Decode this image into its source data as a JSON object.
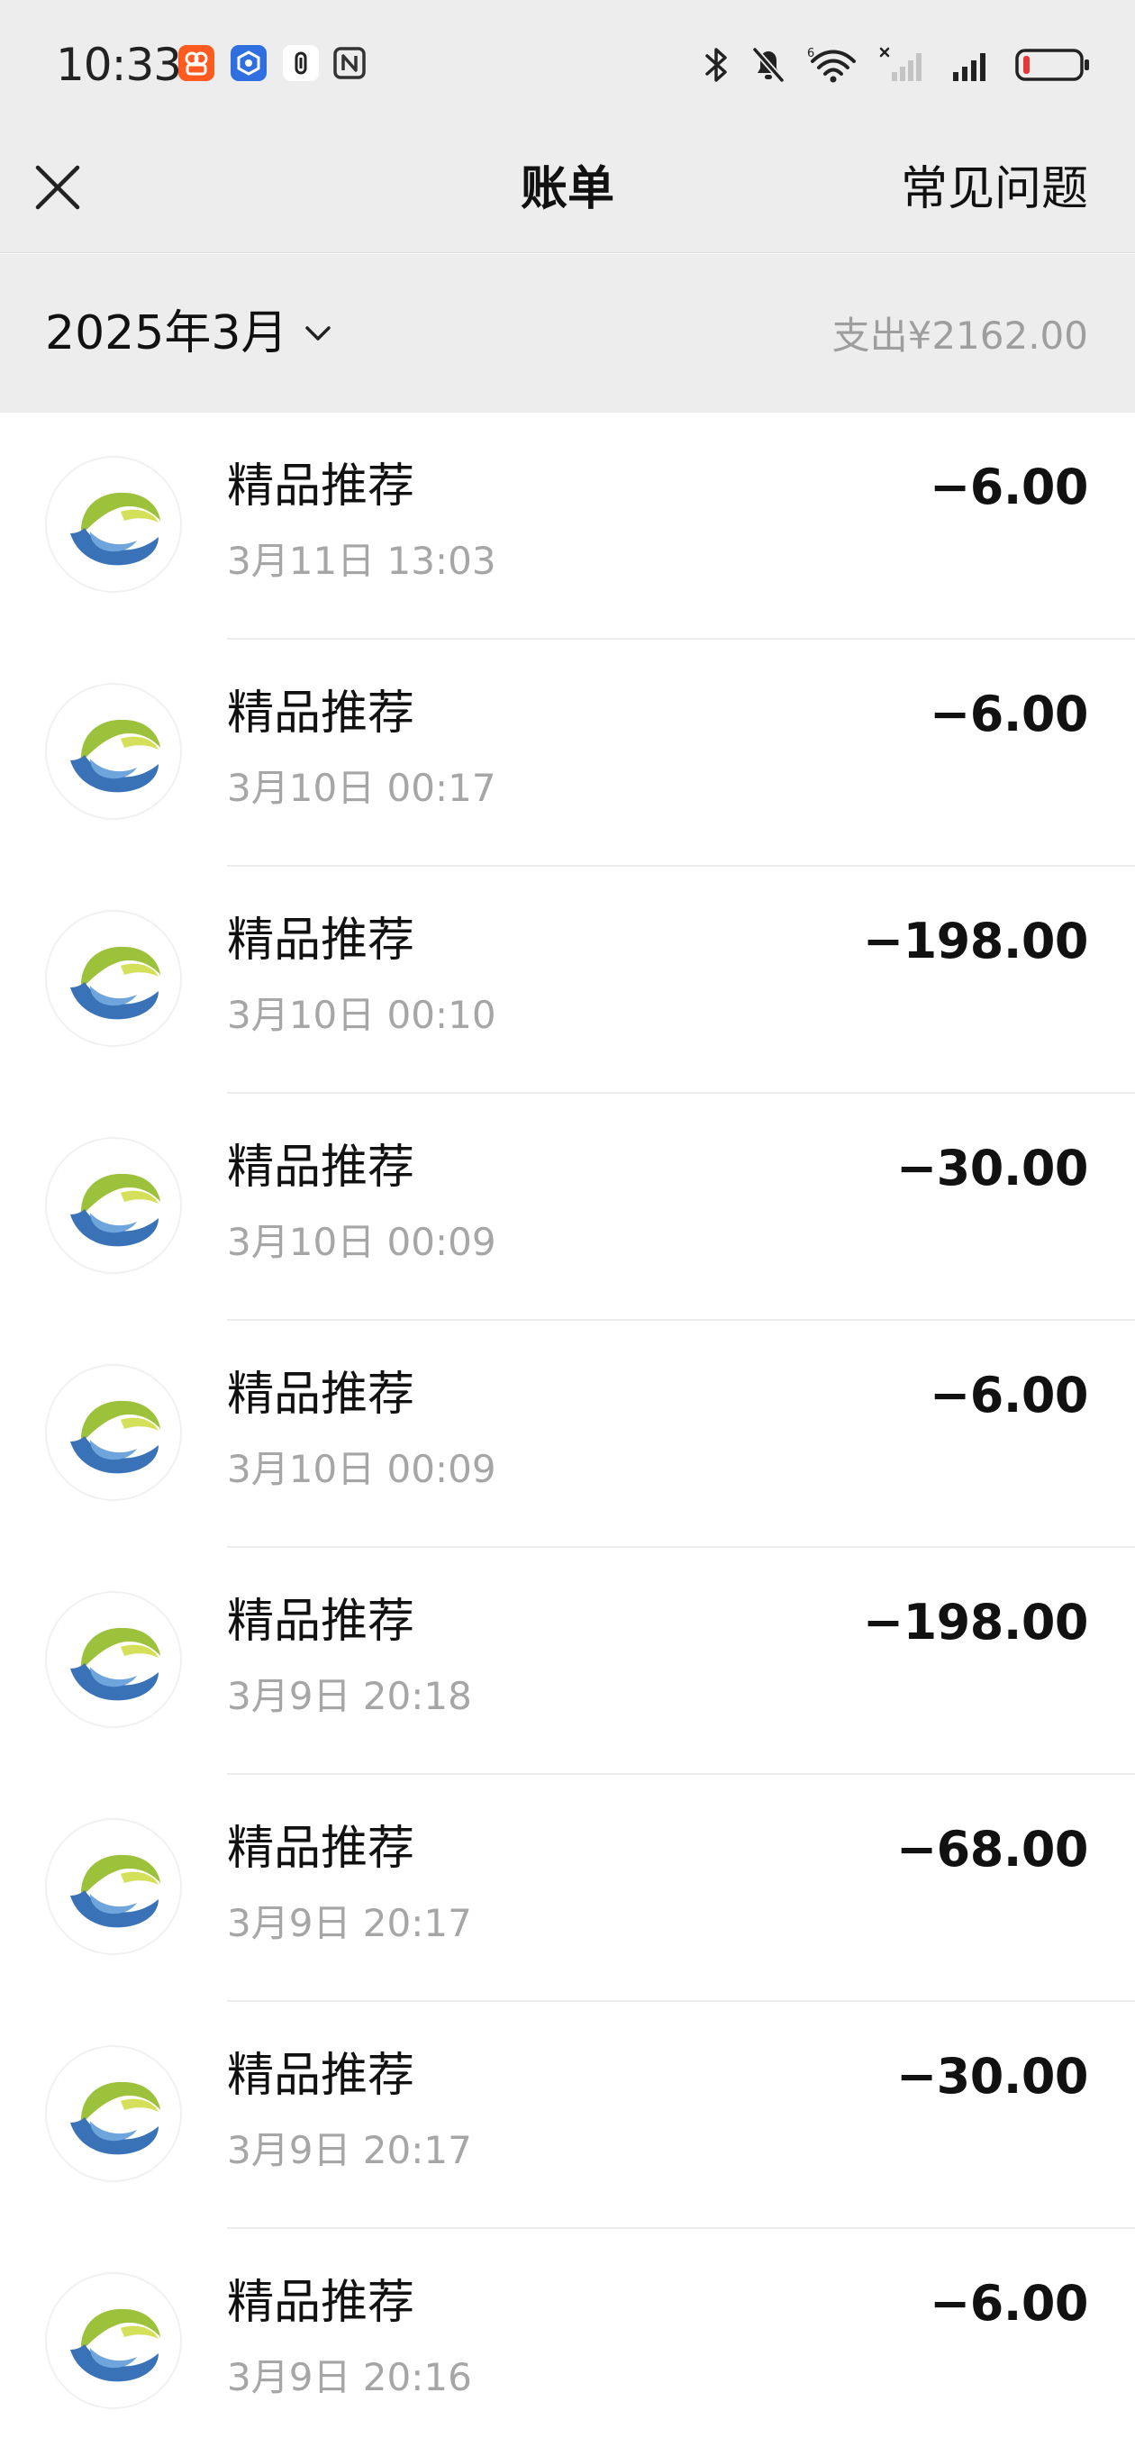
{
  "status_bar": {
    "time": "10:33",
    "left_icons": [
      "kuaishou-app-icon",
      "blue-app-icon",
      "nfc-badge-icon",
      "nfc-icon"
    ],
    "right_icons": [
      "bluetooth-icon",
      "mute-bell-icon",
      "wifi-6-icon",
      "signal-empty-icon",
      "signal-full-icon",
      "battery-low-icon"
    ]
  },
  "nav": {
    "title": "账单",
    "faq_label": "常见问题",
    "close_icon": "close-icon"
  },
  "month_header": {
    "month_label": "2025年3月",
    "total_label": "支出¥2162.00"
  },
  "bills": [
    {
      "name": "精品推荐",
      "time": "3月11日 13:03",
      "amount": "−6.00"
    },
    {
      "name": "精品推荐",
      "time": "3月10日 00:17",
      "amount": "−6.00"
    },
    {
      "name": "精品推荐",
      "time": "3月10日 00:10",
      "amount": "−198.00"
    },
    {
      "name": "精品推荐",
      "time": "3月10日 00:09",
      "amount": "−30.00"
    },
    {
      "name": "精品推荐",
      "time": "3月10日 00:09",
      "amount": "−6.00"
    },
    {
      "name": "精品推荐",
      "time": "3月9日 20:18",
      "amount": "−198.00"
    },
    {
      "name": "精品推荐",
      "time": "3月9日 20:17",
      "amount": "−68.00"
    },
    {
      "name": "精品推荐",
      "time": "3月9日 20:17",
      "amount": "−30.00"
    },
    {
      "name": "精品推荐",
      "time": "3月9日 20:16",
      "amount": "−6.00"
    }
  ],
  "colors": {
    "header_bg": "#ededed",
    "secondary_text": "#a6a6a6",
    "logo_green": "#9cc13a",
    "logo_blue": "#3a72b8",
    "battery_red": "#e53935"
  }
}
